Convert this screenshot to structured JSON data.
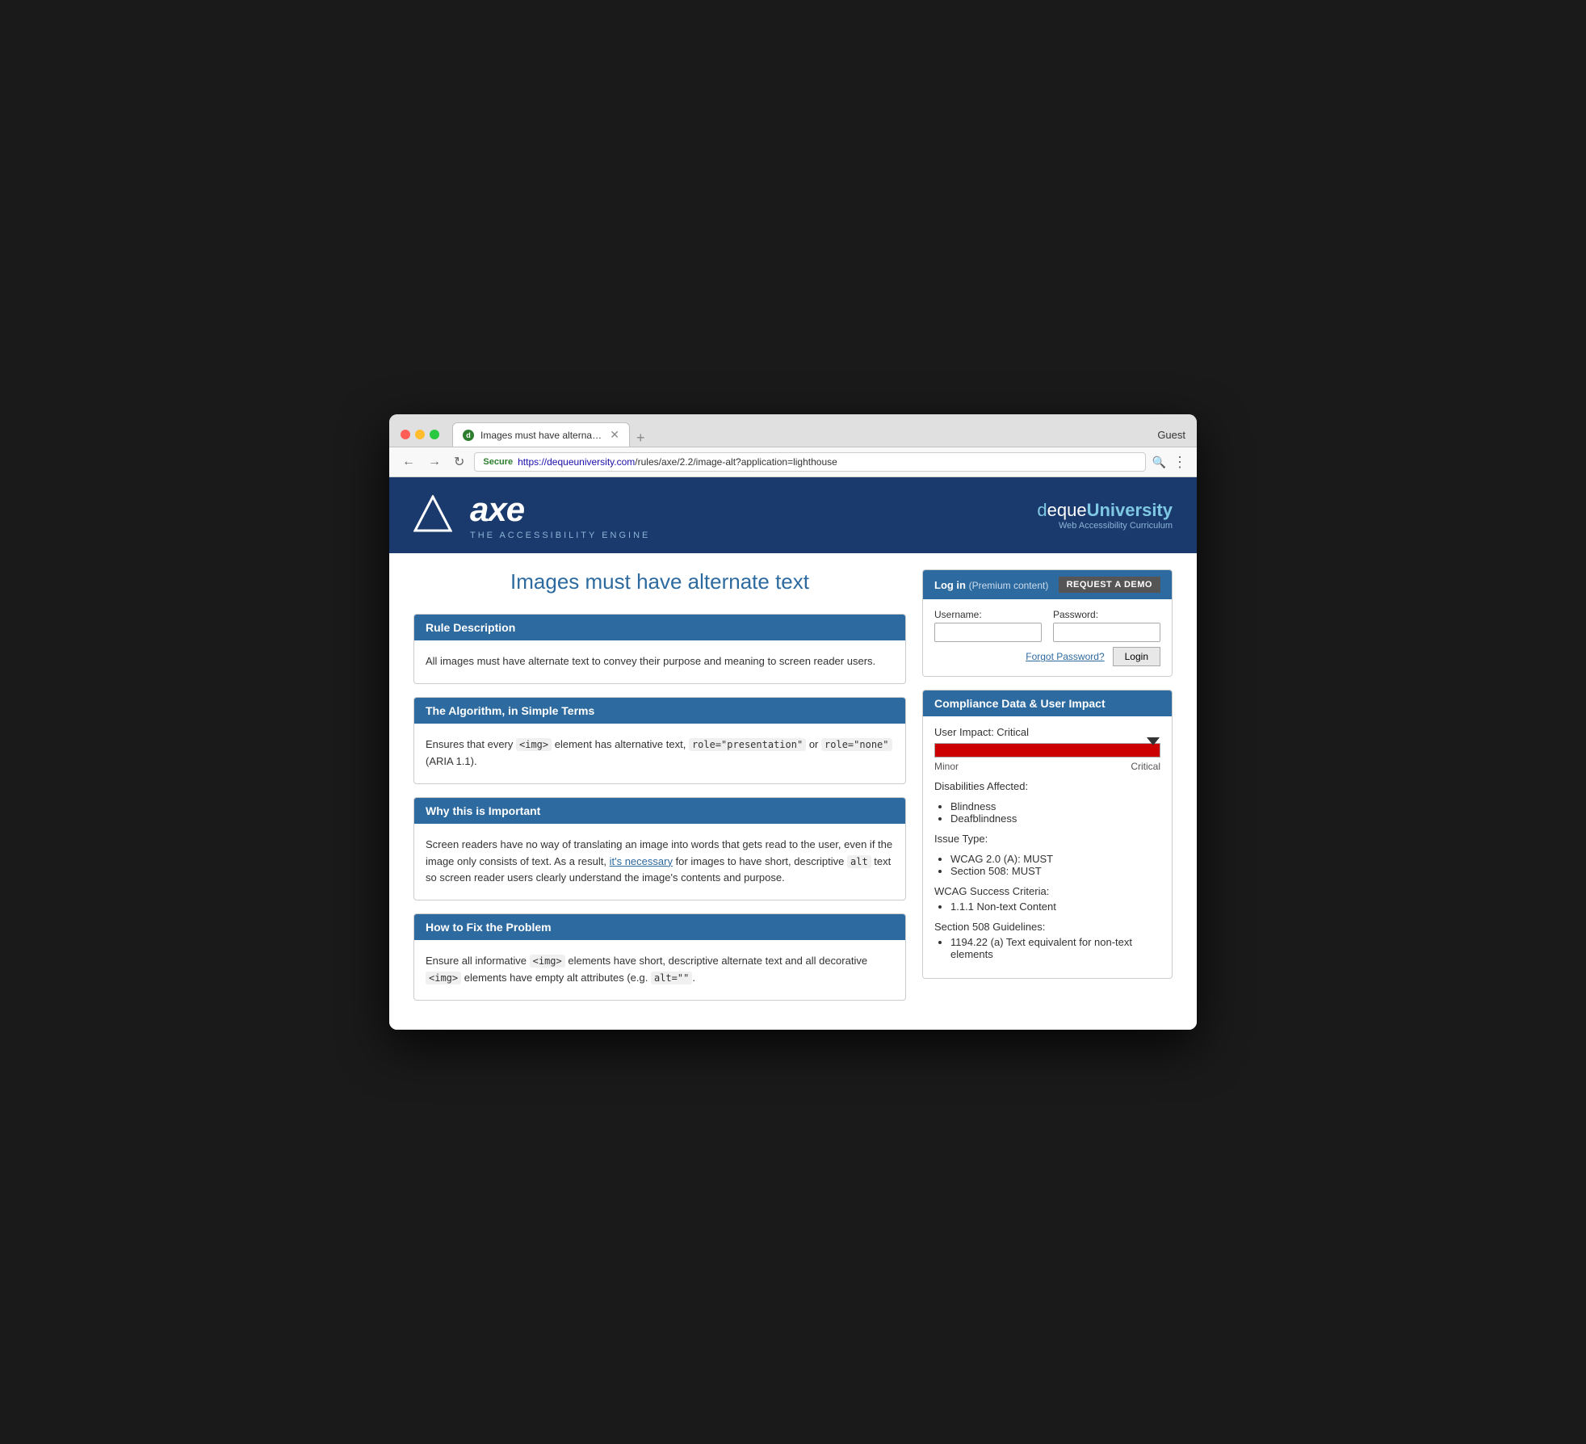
{
  "browser": {
    "tab_title": "Images must have alternate te…",
    "url_secure": "Secure",
    "url_full": "https://dequeuniversity.com/rules/axe/2.2/image-alt?application=lighthouse",
    "url_domain": "dequeuniversity.com",
    "url_path": "/rules/axe/2.2/image-alt?application=lighthouse",
    "guest_label": "Guest"
  },
  "header": {
    "logo_text": "axe",
    "tagline": "THE ACCESSIBILITY ENGINE",
    "deque_brand": "dequeUniversity",
    "deque_subtitle": "Web Accessibility Curriculum"
  },
  "login": {
    "title": "Log in",
    "subtitle": "(Premium content)",
    "request_demo": "REQUEST A DEMO",
    "username_label": "Username:",
    "password_label": "Password:",
    "login_button": "Login",
    "forgot_label": "Forgot Password?"
  },
  "compliance": {
    "title": "Compliance Data & User Impact",
    "user_impact_label": "User Impact: Critical",
    "slider_min": "Minor",
    "slider_max": "Critical",
    "disabilities_title": "Disabilities Affected:",
    "disabilities": [
      "Blindness",
      "Deafblindness"
    ],
    "issue_type_title": "Issue Type:",
    "issue_types": [
      "WCAG 2.0 (A): MUST",
      "Section 508: MUST"
    ],
    "wcag_title": "WCAG Success Criteria:",
    "wcag_items": [
      "1.1.1 Non-text Content"
    ],
    "section508_title": "Section 508 Guidelines:",
    "section508_items": [
      "1194.22 (a) Text equivalent for non-text elements"
    ]
  },
  "page": {
    "title": "Images must have alternate text",
    "rule_description_heading": "Rule Description",
    "rule_description_body": "All images must have alternate text to convey their purpose and meaning to screen reader users.",
    "algorithm_heading": "The Algorithm, in Simple Terms",
    "algorithm_body_1": "Ensures that every ",
    "algorithm_code1": "<img>",
    "algorithm_body_2": " element has alternative text, ",
    "algorithm_code2": "role=\"presentation\"",
    "algorithm_body_3": " or ",
    "algorithm_code3": "role=\"none\"",
    "algorithm_body_4": " (ARIA 1.1).",
    "importance_heading": "Why this is Important",
    "importance_body": "Screen readers have no way of translating an image into words that gets read to the user, even if the image only consists of text. As a result, it’s necessary for images to have short, descriptive alt text so screen reader users clearly understand the image’s contents and purpose.",
    "importance_link_text": "it’s necessary",
    "fix_heading": "How to Fix the Problem",
    "fix_body_1": "Ensure all informative ",
    "fix_code1": "<img>",
    "fix_body_2": " elements have short, descriptive alternate text and all decorative ",
    "fix_code2": "<img>",
    "fix_body_3": " elements have empty alt attributes (e.g. ",
    "fix_code3": "alt=\"\"",
    "fix_body_4": "."
  }
}
